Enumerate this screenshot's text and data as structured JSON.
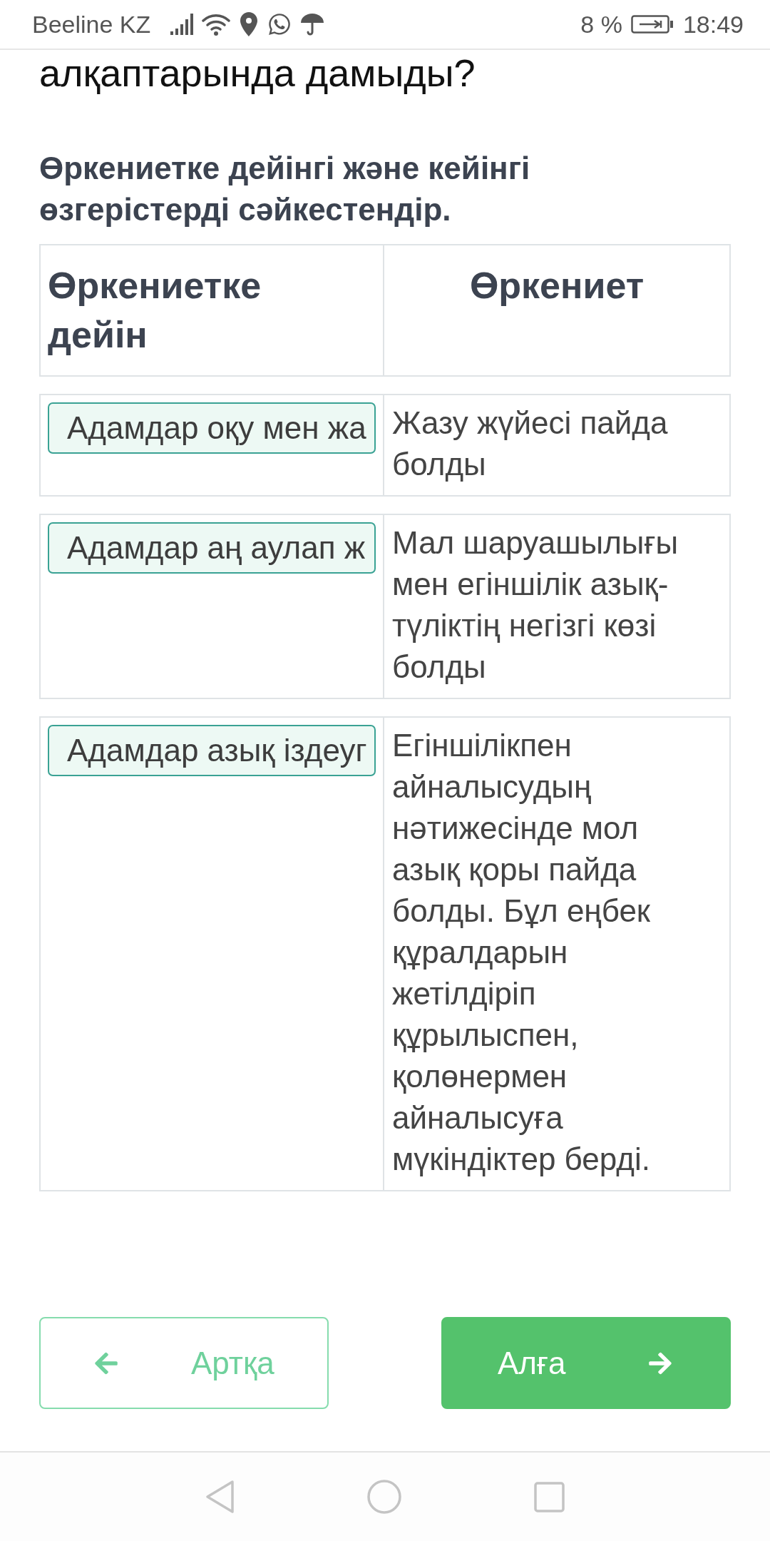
{
  "status_bar": {
    "carrier": "Beeline KZ",
    "battery": "8 %",
    "time": "18:49"
  },
  "question": "алқаптарында дамыды?",
  "instruction": "Өркениетке дейінгі және кейінгі өзгерістерді сәйкестендір.",
  "table": {
    "columns": [
      "Өркениетке дейін",
      "Өркениет"
    ],
    "rows": [
      {
        "answer": "Адамдар оқу мен жа",
        "statement": "Жазу жүйесі пайда болды"
      },
      {
        "answer": "Адамдар аң аулап ж",
        "statement": "Мал шаруашылығы мен егіншілік азық-түліктің негізгі көзі болды"
      },
      {
        "answer": "Адамдар азық іздеуг",
        "statement": "Егіншілікпен айналысудың нәтижесінде мол азық қоры пайда болды. Бұл еңбек құралдарын жетілдіріп құрылыспен, қолөнермен айналысуға мүкіндіктер берді."
      }
    ]
  },
  "buttons": [
    {
      "label": "Артқа",
      "kind": "back"
    },
    {
      "label": "Алға",
      "kind": "next"
    }
  ]
}
